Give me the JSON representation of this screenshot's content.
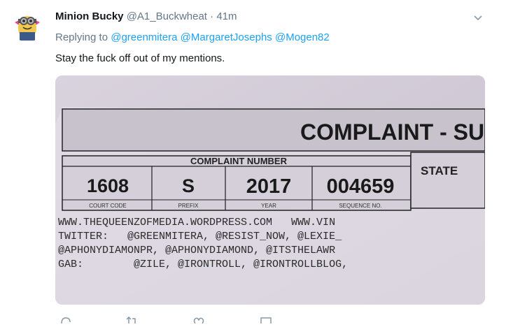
{
  "tweet": {
    "display_name": "Minion Bucky",
    "handle": "@A1_Buckwheat",
    "separator": "·",
    "time": "41m",
    "replying_prefix": "Replying to",
    "replying_to": [
      "@greenmitera",
      "@MargaretJosephs",
      "@Mogen82"
    ],
    "text": "Stay the fuck off out of my mentions."
  },
  "document": {
    "title": "COMPLAINT - SU",
    "complaint_number_label": "COMPLAINT NUMBER",
    "state_label": "STATE",
    "fields": [
      {
        "value": "1608",
        "caption": "COURT CODE"
      },
      {
        "value": "S",
        "caption": "PREFIX"
      },
      {
        "value": "2017",
        "caption": "YEAR"
      },
      {
        "value": "004659",
        "caption": "SEQUENCE NO."
      }
    ],
    "typed_lines": [
      "WWW.THEQUEENZOFMEDIA.WORDPRESS.COM   WWW.VIN",
      "TWITTER:   @GREENMITERA, @RESIST_NOW, @LEXIE_",
      "@APHONYDIAMONPR, @APHONYDIAMOND, @ITSTHELAWR",
      "GAB:        @ZILE, @IRONTROLL, @IRONTROLLBLOG,"
    ]
  },
  "icons": [
    "avatar",
    "chevron-down-icon",
    "reply-icon",
    "retweet-icon",
    "like-icon",
    "message-icon"
  ],
  "colors": {
    "link": "#1da1f2",
    "muted": "#657786",
    "text": "#14171a"
  }
}
